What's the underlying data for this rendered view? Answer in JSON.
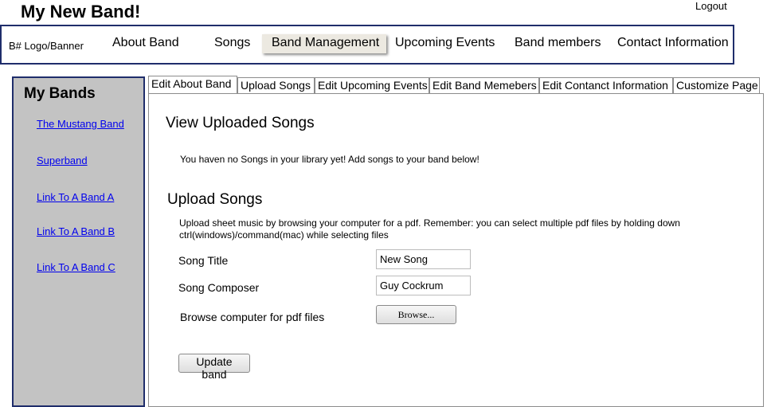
{
  "header": {
    "site_title": "My New Band!",
    "logout_label": "Logout"
  },
  "topnav": {
    "logo_text": "B# Logo/Banner",
    "items": [
      {
        "label": "About Band"
      },
      {
        "label": "Songs"
      },
      {
        "label": "Band Management",
        "active": true
      },
      {
        "label": "Upcoming Events"
      },
      {
        "label": "Band members"
      },
      {
        "label": "Contact Information"
      }
    ]
  },
  "sidebar": {
    "title": "My Bands",
    "links": [
      {
        "label": "The Mustang Band"
      },
      {
        "label": "Superband"
      },
      {
        "label": "Link To A Band A"
      },
      {
        "label": "Link To A Band B"
      },
      {
        "label": "Link To A Band C"
      }
    ]
  },
  "tabs": [
    {
      "label": "Edit About Band",
      "active": true
    },
    {
      "label": "Upload Songs"
    },
    {
      "label": "Edit Upcoming Events"
    },
    {
      "label": "Edit Band Memebers"
    },
    {
      "label": "Edit Contanct Information"
    },
    {
      "label": "Customize Page"
    }
  ],
  "panel": {
    "view_heading": "View Uploaded Songs",
    "empty_message": "You haven no Songs in your library yet! Add songs to your band below!",
    "upload_heading": "Upload Songs",
    "instructions": "Upload sheet music by browsing your computer for a pdf. Remember: you can select multiple pdf files by holding down ctrl(windows)/command(mac) while selecting files",
    "song_title_label": "Song Title",
    "song_title_value": "New Song",
    "song_composer_label": "Song Composer",
    "song_composer_value": "Guy Cockrum",
    "browse_label": "Browse computer for pdf files",
    "browse_button": "Browse...",
    "update_button": "Update band"
  }
}
